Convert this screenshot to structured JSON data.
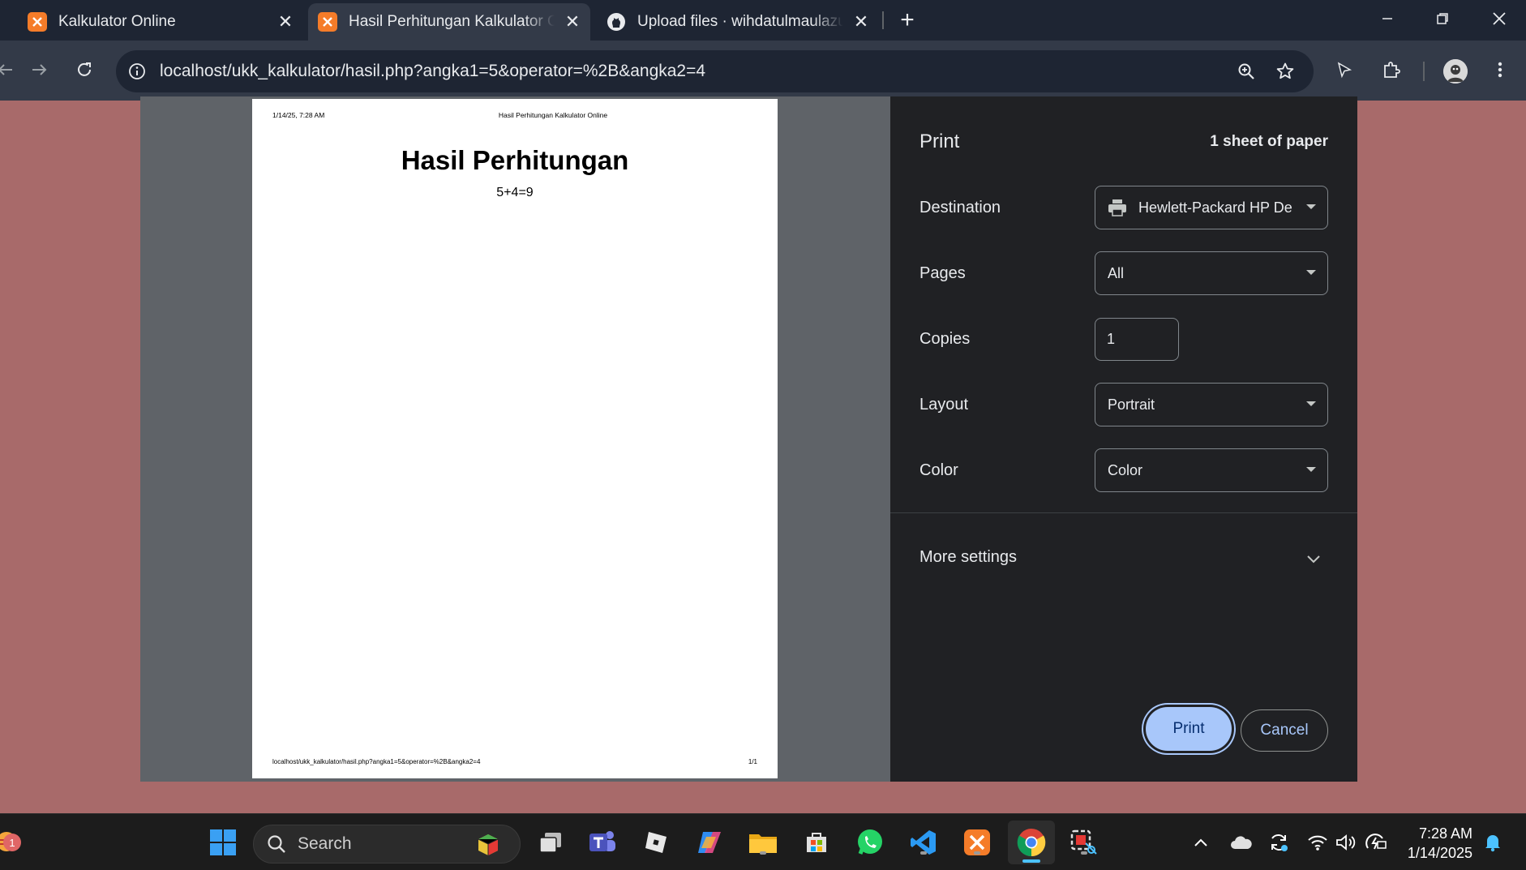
{
  "browser": {
    "tabs": [
      {
        "title": "Kalkulator Online",
        "active": false,
        "icon": "xampp-icon"
      },
      {
        "title": "Hasil Perhitungan Kalkulator Online",
        "active": true,
        "icon": "xampp-icon"
      },
      {
        "title": "Upload files · wihdatulmaulazuhro",
        "active": false,
        "icon": "github-icon"
      }
    ],
    "url": "localhost/ukk_kalkulator/hasil.php?angka1=5&operator=%2B&angka2=4"
  },
  "preview": {
    "header_date": "1/14/25, 7:28 AM",
    "header_title": "Hasil Perhitungan Kalkulator Online",
    "heading": "Hasil Perhitungan",
    "result": "5+4=9",
    "footer_url": "localhost/ukk_kalkulator/hasil.php?angka1=5&operator=%2B&angka2=4",
    "footer_page": "1/1"
  },
  "print_dialog": {
    "title": "Print",
    "sheets": "1 sheet of paper",
    "destination_label": "Destination",
    "destination_value": "Hewlett-Packard HP Deskjet",
    "pages_label": "Pages",
    "pages_value": "All",
    "copies_label": "Copies",
    "copies_value": "1",
    "layout_label": "Layout",
    "layout_value": "Portrait",
    "color_label": "Color",
    "color_value": "Color",
    "more_settings": "More settings",
    "print_button": "Print",
    "cancel_button": "Cancel",
    "accent_color": "#a8c7fa"
  },
  "taskbar": {
    "search_label": "Search",
    "time": "7:28 AM",
    "date": "1/14/2025",
    "weather_badge": "1"
  }
}
